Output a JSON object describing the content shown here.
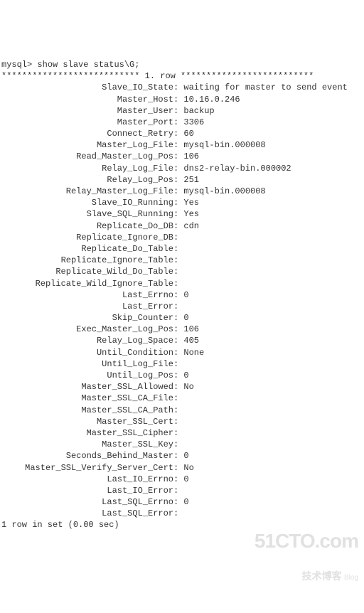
{
  "prompt": "mysql> ",
  "command": "show slave status\\G;",
  "row_header": "*************************** 1. row **************************",
  "fields": [
    {
      "label": "Slave_IO_State",
      "value": "waiting for master to send event"
    },
    {
      "label": "Master_Host",
      "value": "10.16.0.246"
    },
    {
      "label": "Master_User",
      "value": "backup"
    },
    {
      "label": "Master_Port",
      "value": "3306"
    },
    {
      "label": "Connect_Retry",
      "value": "60"
    },
    {
      "label": "Master_Log_File",
      "value": "mysql-bin.000008"
    },
    {
      "label": "Read_Master_Log_Pos",
      "value": "106"
    },
    {
      "label": "Relay_Log_File",
      "value": "dns2-relay-bin.000002"
    },
    {
      "label": "Relay_Log_Pos",
      "value": "251"
    },
    {
      "label": "Relay_Master_Log_File",
      "value": "mysql-bin.000008"
    },
    {
      "label": "Slave_IO_Running",
      "value": "Yes"
    },
    {
      "label": "Slave_SQL_Running",
      "value": "Yes"
    },
    {
      "label": "Replicate_Do_DB",
      "value": "cdn"
    },
    {
      "label": "Replicate_Ignore_DB",
      "value": ""
    },
    {
      "label": "Replicate_Do_Table",
      "value": ""
    },
    {
      "label": "Replicate_Ignore_Table",
      "value": ""
    },
    {
      "label": "Replicate_Wild_Do_Table",
      "value": ""
    },
    {
      "label": "Replicate_Wild_Ignore_Table",
      "value": ""
    },
    {
      "label": "Last_Errno",
      "value": "0"
    },
    {
      "label": "Last_Error",
      "value": ""
    },
    {
      "label": "Skip_Counter",
      "value": "0"
    },
    {
      "label": "Exec_Master_Log_Pos",
      "value": "106"
    },
    {
      "label": "Relay_Log_Space",
      "value": "405"
    },
    {
      "label": "Until_Condition",
      "value": "None"
    },
    {
      "label": "Until_Log_File",
      "value": ""
    },
    {
      "label": "Until_Log_Pos",
      "value": "0"
    },
    {
      "label": "Master_SSL_Allowed",
      "value": "No"
    },
    {
      "label": "Master_SSL_CA_File",
      "value": ""
    },
    {
      "label": "Master_SSL_CA_Path",
      "value": ""
    },
    {
      "label": "Master_SSL_Cert",
      "value": ""
    },
    {
      "label": "Master_SSL_Cipher",
      "value": ""
    },
    {
      "label": "Master_SSL_Key",
      "value": ""
    },
    {
      "label": "Seconds_Behind_Master",
      "value": "0"
    },
    {
      "label": "Master_SSL_Verify_Server_Cert",
      "value": "No"
    },
    {
      "label": "Last_IO_Errno",
      "value": "0"
    },
    {
      "label": "Last_IO_Error",
      "value": ""
    },
    {
      "label": "Last_SQL_Errno",
      "value": "0"
    },
    {
      "label": "Last_SQL_Error",
      "value": ""
    }
  ],
  "footer": "1 row in set (0.00 sec)",
  "watermark": {
    "brand": "51CTO.com",
    "subtitle": "技术博客",
    "tag": "Blog"
  }
}
